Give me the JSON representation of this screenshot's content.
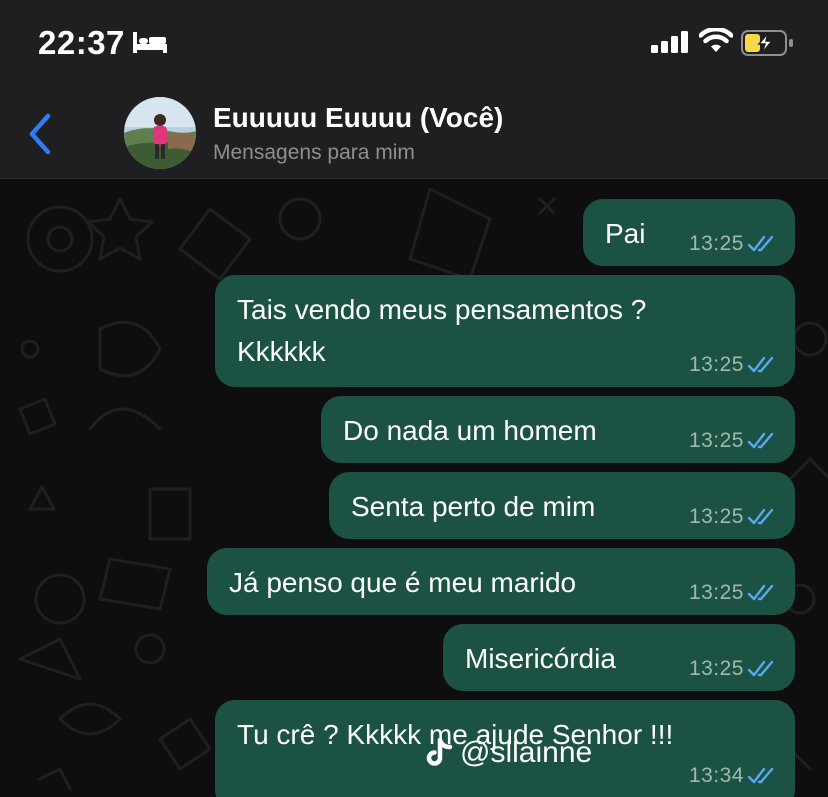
{
  "status_bar": {
    "time": "22:37",
    "icons": [
      "bed-icon",
      "signal-icon",
      "wifi-icon",
      "battery-charging-icon"
    ]
  },
  "header": {
    "contact_name": "Euuuuu Euuuu (Você)",
    "subtitle": "Mensagens para mim"
  },
  "messages": [
    {
      "text": "Pai",
      "time": "13:25",
      "status": "read"
    },
    {
      "text": "Tais vendo meus pensamentos ?\nKkkkkk",
      "time": "13:25",
      "status": "read"
    },
    {
      "text": "Do nada um homem",
      "time": "13:25",
      "status": "read"
    },
    {
      "text": "Senta perto de mim",
      "time": "13:25",
      "status": "read"
    },
    {
      "text": "Já penso que é meu marido",
      "time": "13:25",
      "status": "read"
    },
    {
      "text": "Misericórdia",
      "time": "13:25",
      "status": "read"
    },
    {
      "text": "Tu crê ? Kkkkk me ajude Senhor !!!",
      "time": "13:34",
      "status": "read"
    }
  ],
  "watermark": {
    "icon": "tiktok-icon",
    "handle": "@sllainne"
  },
  "colors": {
    "bubble": "#1c5243",
    "header": "#1f1f21",
    "tick": "#5aa8f0",
    "back": "#2f7cf6",
    "battery": "#f6d84a"
  }
}
